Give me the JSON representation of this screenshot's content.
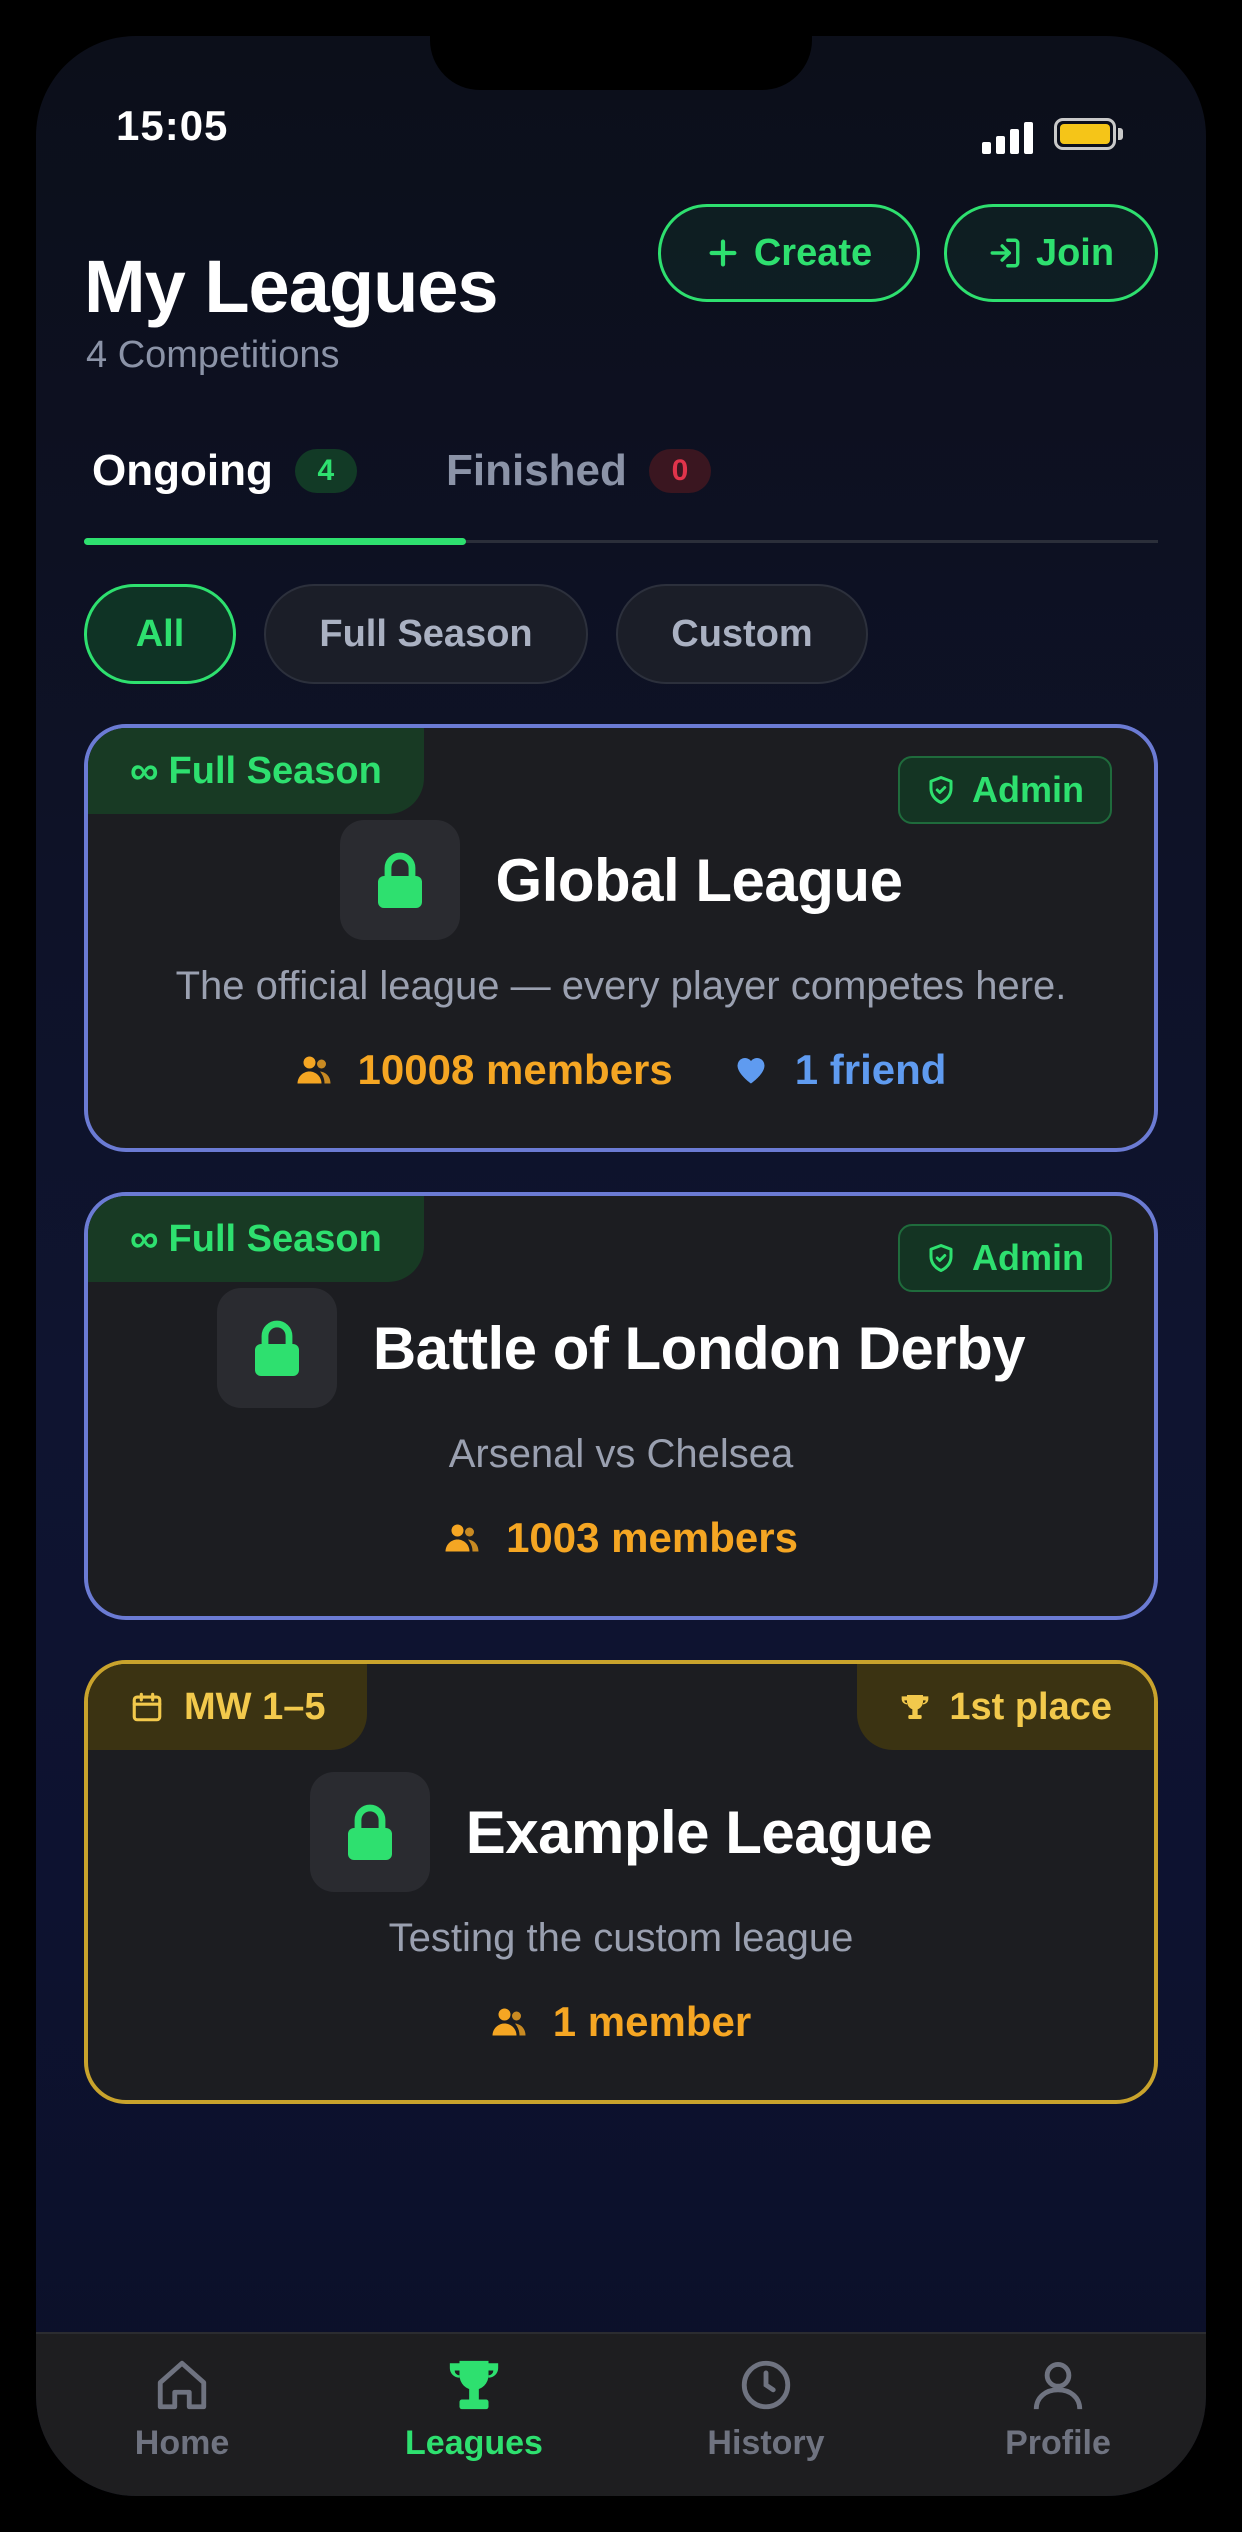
{
  "status": {
    "time": "15:05"
  },
  "header": {
    "title": "My Leagues",
    "subtitle": "4 Competitions",
    "create_label": "Create",
    "join_label": "Join"
  },
  "tabs": [
    {
      "label": "Ongoing",
      "count": "4",
      "active": true
    },
    {
      "label": "Finished",
      "count": "0",
      "active": false
    }
  ],
  "filters": [
    {
      "label": "All",
      "active": true
    },
    {
      "label": "Full Season",
      "active": false
    },
    {
      "label": "Custom",
      "active": false
    }
  ],
  "leagues": [
    {
      "tag": "Full Season",
      "role": "Admin",
      "name": "Global League",
      "description": "The official league — every player competes here.",
      "members": "10008 members",
      "friends": "1 friend"
    },
    {
      "tag": "Full Season",
      "role": "Admin",
      "name": "Battle of London Derby",
      "description": "Arsenal vs Chelsea",
      "members": "1003 members"
    },
    {
      "tag": "MW 1–5",
      "rank": "1st place",
      "name": "Example League",
      "description": "Testing the custom league",
      "members": "1 member"
    }
  ],
  "nav": [
    {
      "label": "Home",
      "icon": "home-icon"
    },
    {
      "label": "Leagues",
      "icon": "trophy-icon",
      "active": true
    },
    {
      "label": "History",
      "icon": "clock-icon"
    },
    {
      "label": "Profile",
      "icon": "user-icon"
    }
  ],
  "colors": {
    "accent": "#2ee06f",
    "members": "#f5a623",
    "friends": "#5f9bf0",
    "card_border": "#6b7bd4",
    "gold": "#f2c94c"
  }
}
